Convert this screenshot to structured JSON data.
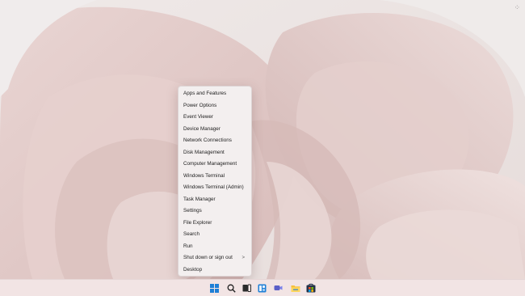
{
  "context_menu": {
    "items": [
      {
        "label": "Apps and Features"
      },
      {
        "label": "Power Options"
      },
      {
        "label": "Event Viewer"
      },
      {
        "label": "Device Manager"
      },
      {
        "label": "Network Connections"
      },
      {
        "label": "Disk Management"
      },
      {
        "label": "Computer Management"
      },
      {
        "label": "Windows Terminal"
      },
      {
        "label": "Windows Terminal (Admin)"
      },
      {
        "label": "Task Manager"
      },
      {
        "label": "Settings"
      },
      {
        "label": "File Explorer"
      },
      {
        "label": "Search"
      },
      {
        "label": "Run"
      },
      {
        "label": "Shut down or sign out",
        "submenu": ">"
      },
      {
        "label": "Desktop"
      }
    ]
  },
  "taskbar": {
    "icons": [
      "start-icon",
      "search-icon",
      "task-view-icon",
      "widgets-icon",
      "chat-icon",
      "edge-icon",
      "file-explorer-icon",
      "store-icon"
    ]
  },
  "colors": {
    "wallpaper_bg": "#ece4e2",
    "petal": "#dcc3c1",
    "menu_bg": "#f3efef",
    "taskbar_bg": "#f2e4e4",
    "accent_blue": "#1f7fd6"
  }
}
